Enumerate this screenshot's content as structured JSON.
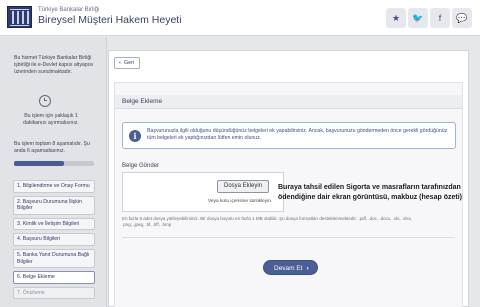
{
  "header": {
    "org_name": "Türkiye Bankalar Birliği",
    "app_title": "Bireysel Müşteri Hakem Heyeti",
    "buttons": [
      {
        "name": "star-icon-button",
        "glyph": "★"
      },
      {
        "name": "twitter-icon-button",
        "glyph": "🐦"
      },
      {
        "name": "facebook-icon-button",
        "glyph": "f"
      },
      {
        "name": "chat-icon-button",
        "glyph": "💬"
      }
    ]
  },
  "sidebar": {
    "info_text": "Bu hizmet Türkiye Bankalar Birliği işbirliği ile e-Devlet kapısı altyapısı üzerinden sunulmaktadır.",
    "time_text": "Bu işlem için yaklaşık 1 dakikanızı ayırmalısınız.",
    "steps_text": "Bu işlem toplam 8 aşamalıdır. Şu anda 6 aşamadasınız.",
    "progress_fraction": 0.625,
    "steps": [
      {
        "label": "1. Bilgilendirme ve Onay Formu",
        "state": "done"
      },
      {
        "label": "2. Başvuru Durumuna İlişkin Bilgiler",
        "state": "done"
      },
      {
        "label": "3. Kimlik ve İletişim Bilgileri",
        "state": "done"
      },
      {
        "label": "4. Başvuru Bilgileri",
        "state": "done"
      },
      {
        "label": "5. Banka Yanıt Durumuna Bağlı Bilgiler",
        "state": "done"
      },
      {
        "label": "6. Belge Ekleme",
        "state": "active"
      },
      {
        "label": "7. Önizleme",
        "state": "muted"
      }
    ]
  },
  "main": {
    "back_label": "Geri",
    "section_title": "Belge Ekleme",
    "info_message": "Başvurunuzla ilgili olduğunu düşündüğünüz belgeleri ek yapabilirsiniz. Ancak, başvurunuzu göndermeden önce gerekli gördüğünüz tüm belgeleri ek yaptığınızdan lütfen emin olunuz.",
    "upload_label": "Belge Gönder",
    "upload_button": "Dosya Ekleyin",
    "drag_text": "Veya kutu içerisine sürükleyin.",
    "hint": "En fazla 5 adet dosya yükleyebilirsiniz. Bir dosya boyutu en fazla 1 MB olabilir. Şu dosya formatları desteklenmektedir: .pdf, .doc, .docx, .xls, .xlsx, .png, .jpeg, .tif, .tiff, .bmp",
    "continue_label": "Devam Et"
  },
  "annotation": "Buraya tahsil edilen Sigorta ve masrafların tarafınızdan ödendiğine dair ekran görüntüsü, makbuz (hesap özeti)"
}
